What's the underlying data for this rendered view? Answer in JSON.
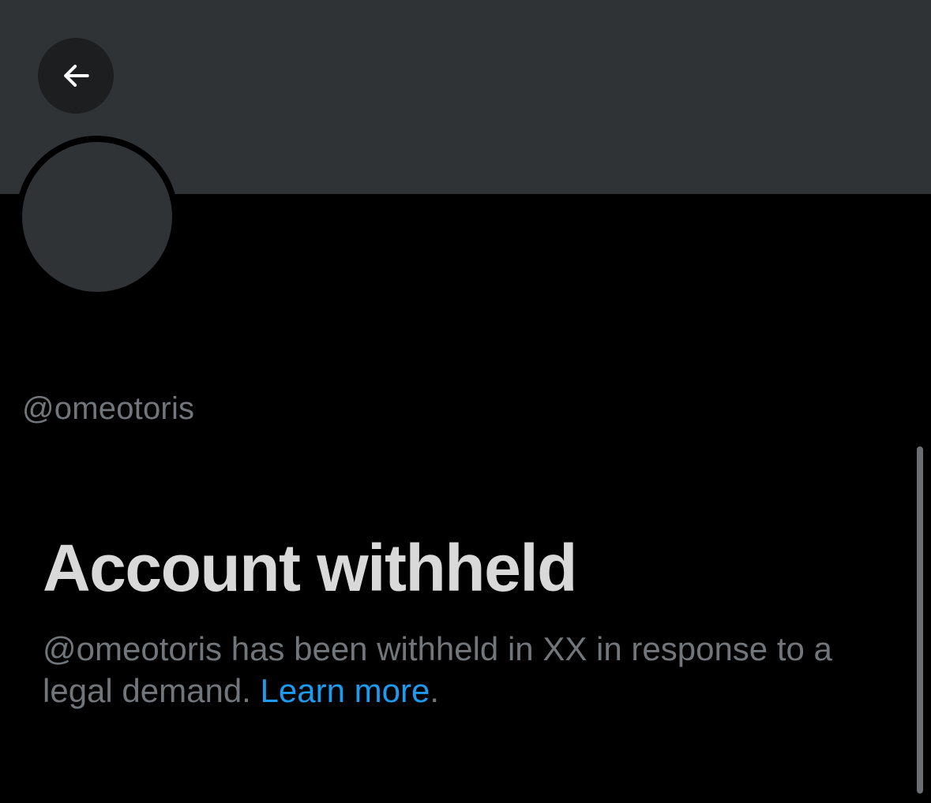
{
  "profile": {
    "handle": "@omeotoris"
  },
  "notice": {
    "title": "Account withheld",
    "description": "@omeotoris has been withheld in XX in response to a legal demand.",
    "link_label": "Learn more",
    "trailing_period": "."
  },
  "icons": {
    "back": "arrow-left-icon"
  },
  "colors": {
    "background": "#000000",
    "banner": "#2f3336",
    "secondary_text": "#71767b",
    "title_text": "#d9d9d9",
    "link": "#1d9bf0"
  }
}
